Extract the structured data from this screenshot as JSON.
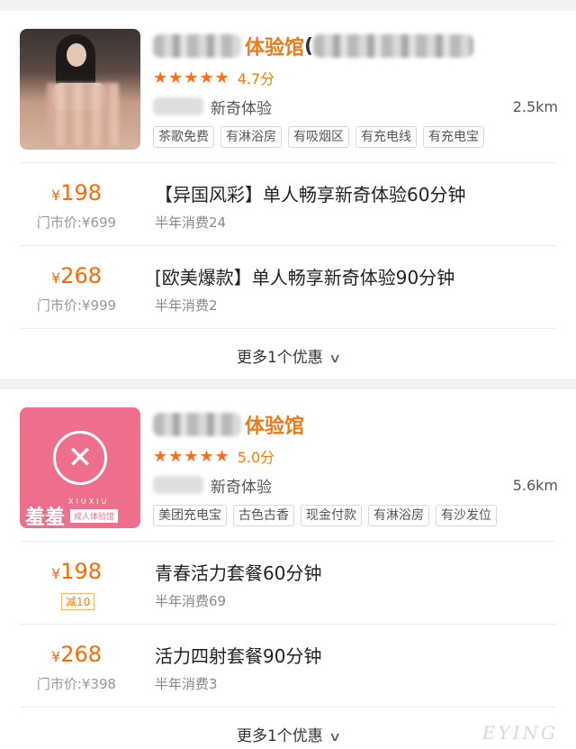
{
  "shops": [
    {
      "title": "体验馆",
      "paren": "(",
      "stars": "★★★★★",
      "score": "4.7分",
      "category": "新奇体验",
      "distance": "2.5km",
      "tags": [
        "茶歌免费",
        "有淋浴房",
        "有吸烟区",
        "有充电线",
        "有充电宝"
      ],
      "deals": [
        {
          "price": "198",
          "currency": "¥",
          "orig": "门市价:¥699",
          "title": "【异国风彩】单人畅享新奇体验60分钟",
          "sales": "半年消费24"
        },
        {
          "price": "268",
          "currency": "¥",
          "orig": "门市价:¥999",
          "title": "[欧美爆款】单人畅享新奇体验90分钟",
          "sales": "半年消费2"
        }
      ],
      "more": "更多1个优惠"
    },
    {
      "title": "体验馆",
      "stars": "★★★★★",
      "score": "5.0分",
      "category": "新奇体验",
      "distance": "5.6km",
      "brand": {
        "name": "羞羞",
        "en": "XIUXIU",
        "tag": "成人体验馆",
        "color": "#ee6f8c"
      },
      "tags": [
        "美团充电宝",
        "古色古香",
        "现金付款",
        "有淋浴房",
        "有沙发位"
      ],
      "deals": [
        {
          "price": "198",
          "currency": "¥",
          "discount": "减10",
          "title": "青春活力套餐60分钟",
          "sales": "半年消费69"
        },
        {
          "price": "268",
          "currency": "¥",
          "orig": "门市价:¥398",
          "title": "活力四射套餐90分钟",
          "sales": "半年消费3"
        }
      ],
      "more": "更多1个优惠"
    }
  ],
  "icons": {
    "chevron": "chevron-down-icon",
    "star": "star-icon"
  },
  "colors": {
    "accent": "#f07a18",
    "price": "#ff6a00"
  },
  "watermark": "EYING"
}
